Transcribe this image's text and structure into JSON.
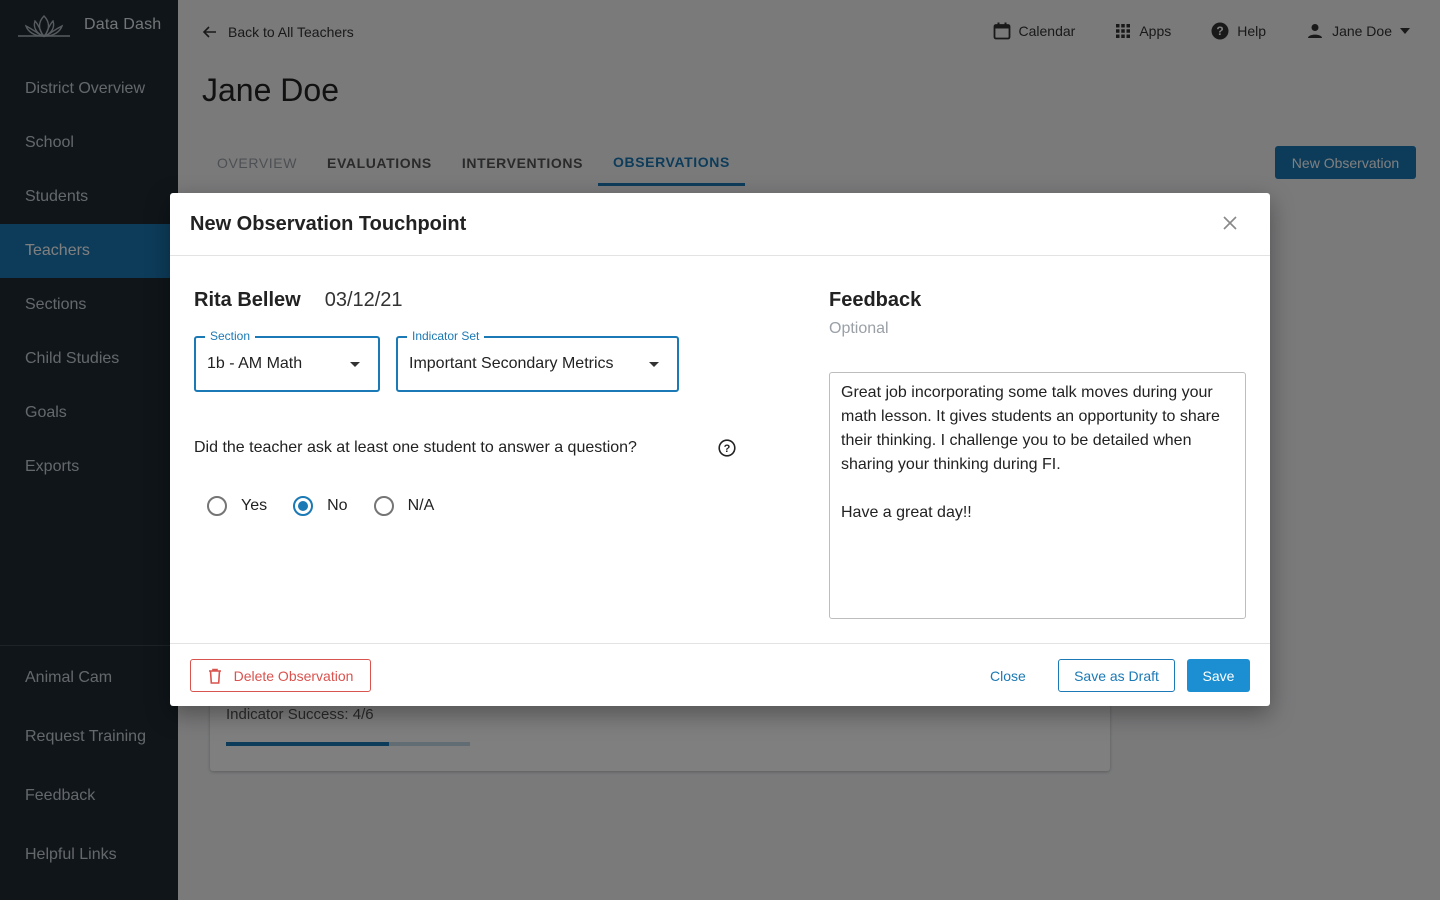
{
  "app": {
    "name": "Data Dash"
  },
  "sidebar": {
    "items": [
      {
        "label": "District Overview"
      },
      {
        "label": "School"
      },
      {
        "label": "Students"
      },
      {
        "label": "Teachers",
        "active": true
      },
      {
        "label": "Sections"
      },
      {
        "label": "Child Studies"
      },
      {
        "label": "Goals"
      },
      {
        "label": "Exports"
      }
    ],
    "bottom_items": [
      {
        "label": "Animal Cam"
      },
      {
        "label": "Request Training"
      },
      {
        "label": "Feedback"
      },
      {
        "label": "Helpful Links"
      }
    ]
  },
  "header": {
    "back_label": "Back to All Teachers",
    "calendar_label": "Calendar",
    "apps_label": "Apps",
    "help_label": "Help",
    "user_label": "Jane Doe"
  },
  "page": {
    "title": "Jane Doe",
    "tabs": [
      {
        "label": "OVERVIEW"
      },
      {
        "label": "EVALUATIONS"
      },
      {
        "label": "INTERVENTIONS"
      },
      {
        "label": "OBSERVATIONS",
        "active": true
      }
    ],
    "new_observation_label": "New Observation",
    "card": {
      "indicator_label": "Indicator Success: 4/6",
      "progress": 0.6667
    }
  },
  "modal": {
    "title": "New Observation Touchpoint",
    "teacher_name": "Rita Bellew",
    "date": "03/12/21",
    "section": {
      "label": "Section",
      "value": "1b - AM Math"
    },
    "indicator_set": {
      "label": "Indicator Set",
      "value": "Important Secondary Metrics"
    },
    "question": "Did the teacher ask at least one student to answer a question?",
    "options": [
      {
        "label": "Yes",
        "checked": false
      },
      {
        "label": "No",
        "checked": true
      },
      {
        "label": "N/A",
        "checked": false
      }
    ],
    "feedback": {
      "title": "Feedback",
      "optional_label": "Optional",
      "text": "Great job incorporating some talk moves during your math lesson. It gives students an opportunity to share their thinking. I challenge you to be detailed when sharing your thinking during FI.\n\nHave a great day!!"
    },
    "footer": {
      "delete_label": "Delete Observation",
      "close_label": "Close",
      "draft_label": "Save as Draft",
      "save_label": "Save"
    }
  },
  "colors": {
    "accent": "#1b79b5",
    "danger": "#d9534f",
    "sidebar_bg": "#1f2a33"
  }
}
